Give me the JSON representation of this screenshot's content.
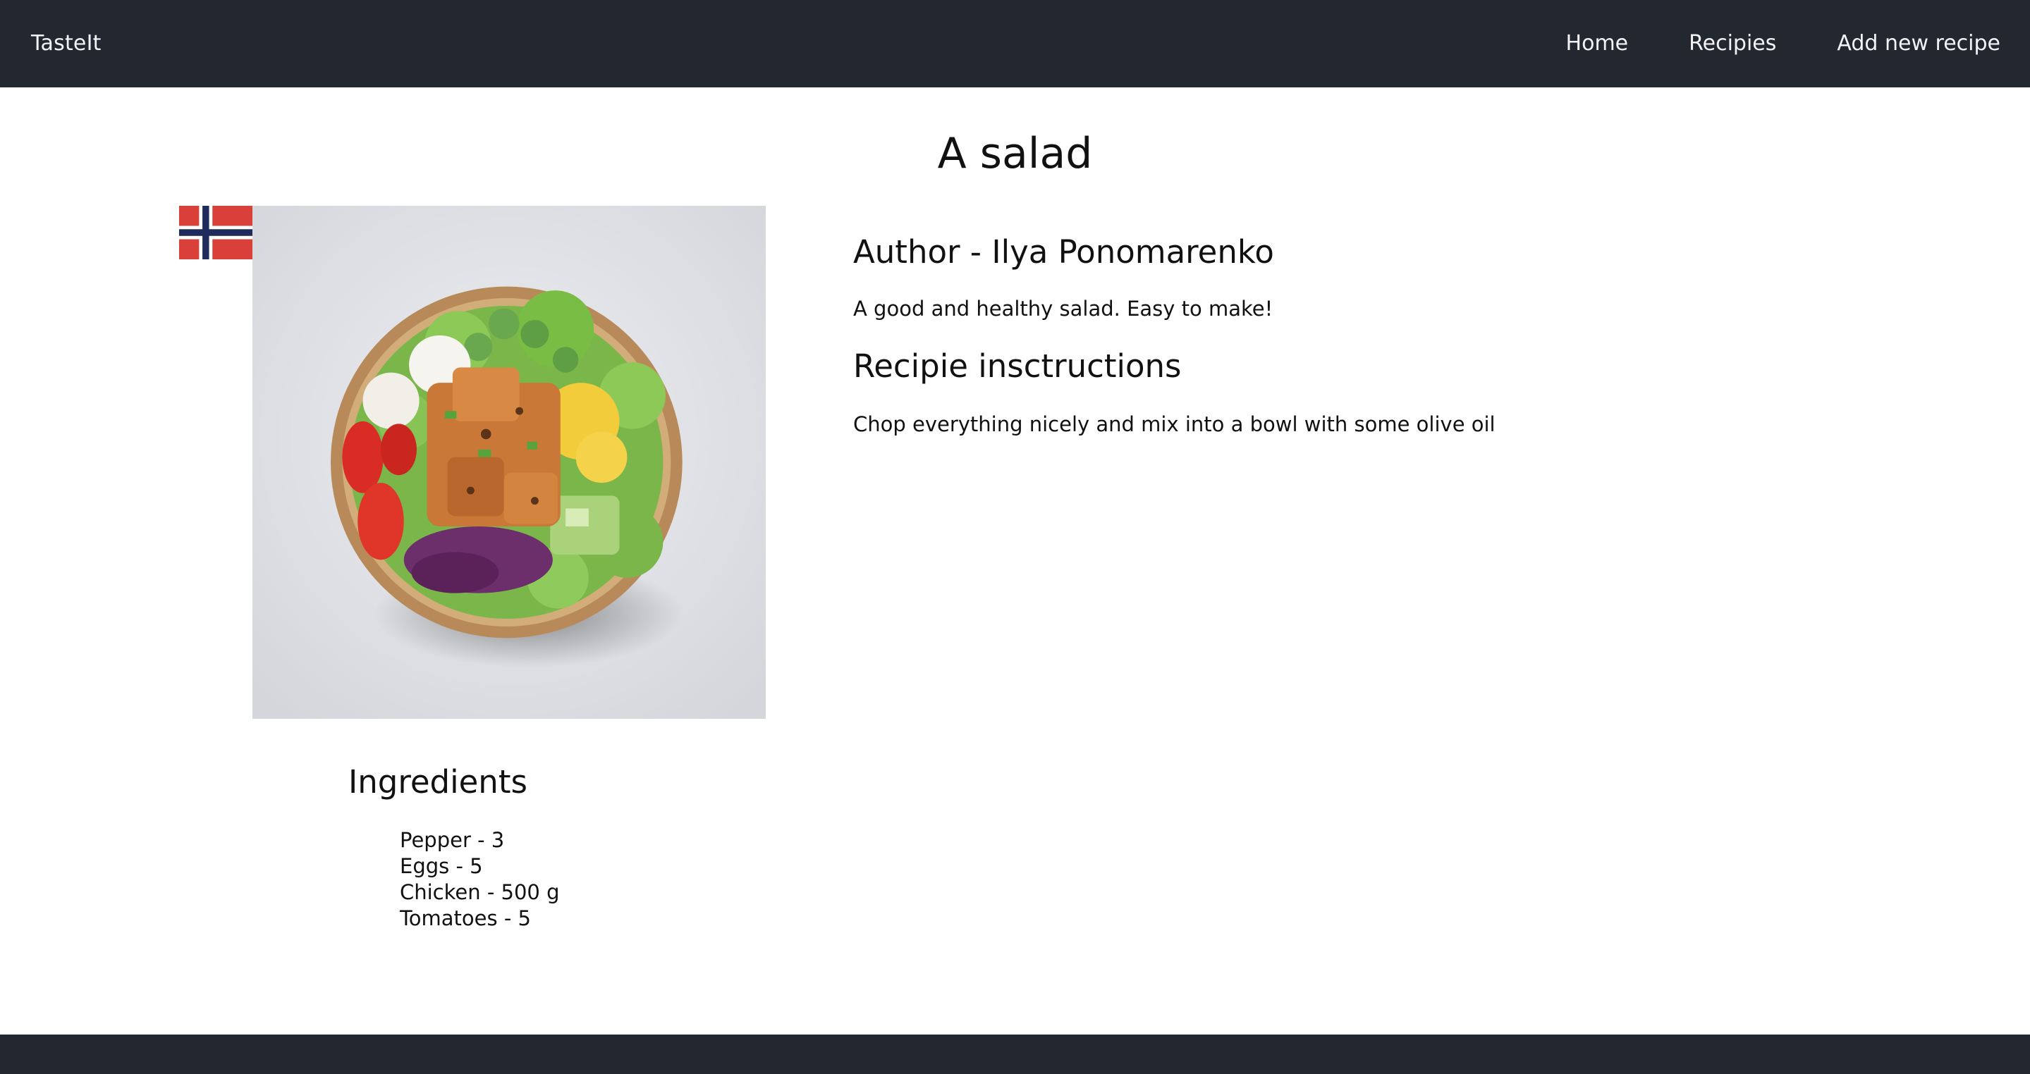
{
  "colors": {
    "nav_background": "#232730",
    "nav_text": "#f2f3f5",
    "page_background": "#ffffff",
    "text": "#111111",
    "flag_red": "#d9403a",
    "flag_blue": "#1f2b5c"
  },
  "nav": {
    "brand": "TasteIt",
    "links": [
      {
        "label": "Home"
      },
      {
        "label": "Recipies"
      },
      {
        "label": "Add new recipe"
      }
    ]
  },
  "recipe": {
    "title": "A salad",
    "country_flag_icon": "norway-flag-icon",
    "photo_icon": "salad-bowl-photo",
    "author": "Author - Ilya Ponomarenko",
    "description": "A good and healthy salad. Easy to make!",
    "instructions_heading": "Recipie insctructions",
    "instructions": "Chop everything nicely and mix into a bowl with some olive oil",
    "ingredients_heading": "Ingredients",
    "ingredients": [
      "Pepper - 3",
      "Eggs - 5",
      "Chicken - 500 g",
      "Tomatoes - 5"
    ]
  }
}
